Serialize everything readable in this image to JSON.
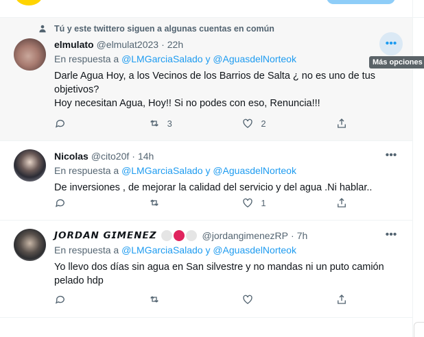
{
  "tooltip": "Más opciones",
  "tweets": [
    {
      "social_context": "Tú y este twittero siguen a algunas cuentas en común",
      "name": "elmulato",
      "handle": "@elmulat2023",
      "time": "22h",
      "reply_prefix": "En respuesta a",
      "reply_mention_1": "@LMGarciaSalado",
      "reply_joiner": "y",
      "reply_mention_2": "@AguasdelNorteok",
      "text_lines": [
        "Darle Agua Hoy, a los Vecinos de los Barrios de Salta ¿ no es uno de tus",
        "objetivos?",
        "Hoy necesitan Agua, Hoy!! Si no podes con eso, Renuncia!!!"
      ],
      "replies": "",
      "retweets": "3",
      "likes": "2"
    },
    {
      "name": "Nicolas",
      "handle": "@cito20f",
      "time": "14h",
      "reply_prefix": "En respuesta a",
      "reply_mention_1": "@LMGarciaSalado",
      "reply_joiner": "y",
      "reply_mention_2": "@AguasdelNorteok",
      "text_lines": [
        "De inversiones , de mejorar la calidad del servicio y del agua .Ni hablar.."
      ],
      "replies": "",
      "retweets": "",
      "likes": "1"
    },
    {
      "name": "𝙅𝙊𝙍𝘿𝘼𝙉 𝙂𝙄𝙈𝙀𝙉𝙀𝙕",
      "handle": "@jordangimenezRP",
      "time": "7h",
      "reply_prefix": "En respuesta a",
      "reply_mention_1": "@LMGarciaSalado",
      "reply_joiner": "y",
      "reply_mention_2": "@AguasdelNorteok",
      "text_lines": [
        "Yo llevo dos días sin agua en San silvestre y no mandas ni un puto camión",
        "pelado hdp"
      ],
      "replies": "",
      "retweets": "",
      "likes": ""
    }
  ],
  "icons": {
    "social": "person-icon",
    "reply": "reply-icon",
    "retweet": "retweet-icon",
    "like": "heart-icon",
    "share": "share-icon",
    "more": "more-options-icon"
  },
  "colors": {
    "link": "#1d9bf0",
    "secondary_text": "#536471",
    "hover_background": "#f7f7f7",
    "badge_red": "#e0245e"
  }
}
